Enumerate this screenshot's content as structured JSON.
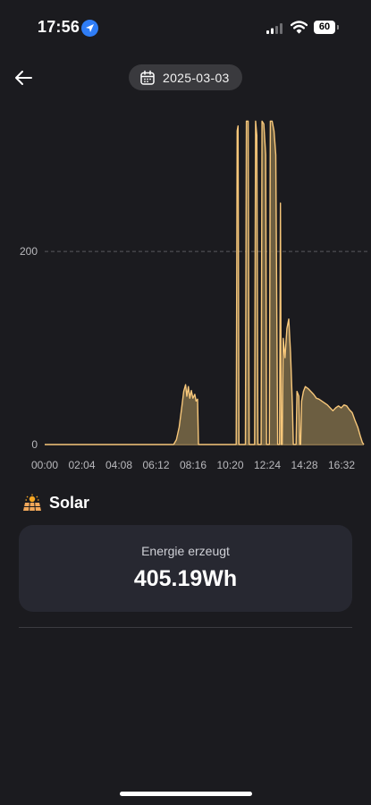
{
  "status_bar": {
    "time": "17:56",
    "battery": "60"
  },
  "header": {
    "date": "2025-03-03"
  },
  "chart_data": {
    "type": "area",
    "x_tick_labels": [
      "00:00",
      "02:04",
      "04:08",
      "06:12",
      "08:16",
      "10:20",
      "12:24",
      "14:28",
      "16:32"
    ],
    "y_ticks": [
      0,
      200
    ],
    "ylim": [
      0,
      340
    ],
    "xlim_hours": [
      0,
      17.33
    ],
    "grid": "horizontal dashed at 200",
    "color": "#f7c77a",
    "fill_color": "#7a6a48",
    "points": [
      [
        0.0,
        0
      ],
      [
        7.0,
        0
      ],
      [
        7.15,
        5
      ],
      [
        7.3,
        18
      ],
      [
        7.45,
        40
      ],
      [
        7.55,
        55
      ],
      [
        7.65,
        62
      ],
      [
        7.72,
        50
      ],
      [
        7.8,
        60
      ],
      [
        7.88,
        48
      ],
      [
        7.96,
        56
      ],
      [
        8.05,
        48
      ],
      [
        8.15,
        52
      ],
      [
        8.22,
        45
      ],
      [
        8.3,
        47
      ],
      [
        8.35,
        0
      ],
      [
        10.4,
        0
      ],
      [
        10.45,
        325
      ],
      [
        10.5,
        330
      ],
      [
        10.55,
        0
      ],
      [
        10.9,
        0
      ],
      [
        10.95,
        335
      ],
      [
        11.05,
        335
      ],
      [
        11.1,
        0
      ],
      [
        11.4,
        0
      ],
      [
        11.45,
        335
      ],
      [
        11.52,
        320
      ],
      [
        11.58,
        0
      ],
      [
        11.75,
        0
      ],
      [
        11.8,
        335
      ],
      [
        11.9,
        332
      ],
      [
        12.0,
        300
      ],
      [
        12.05,
        0
      ],
      [
        12.2,
        0
      ],
      [
        12.25,
        335
      ],
      [
        12.35,
        335
      ],
      [
        12.45,
        325
      ],
      [
        12.55,
        300
      ],
      [
        12.65,
        0
      ],
      [
        12.75,
        0
      ],
      [
        12.8,
        250
      ],
      [
        12.85,
        0
      ],
      [
        12.9,
        0
      ],
      [
        12.95,
        110
      ],
      [
        13.05,
        90
      ],
      [
        13.15,
        120
      ],
      [
        13.25,
        130
      ],
      [
        13.35,
        95
      ],
      [
        13.45,
        40
      ],
      [
        13.5,
        0
      ],
      [
        13.65,
        0
      ],
      [
        13.7,
        55
      ],
      [
        13.8,
        50
      ],
      [
        13.85,
        0
      ],
      [
        13.9,
        0
      ],
      [
        13.95,
        45
      ],
      [
        14.05,
        55
      ],
      [
        14.15,
        60
      ],
      [
        14.3,
        58
      ],
      [
        14.45,
        55
      ],
      [
        14.6,
        52
      ],
      [
        14.75,
        48
      ],
      [
        14.9,
        47
      ],
      [
        15.05,
        45
      ],
      [
        15.2,
        43
      ],
      [
        15.35,
        41
      ],
      [
        15.5,
        38
      ],
      [
        15.65,
        35
      ],
      [
        15.8,
        38
      ],
      [
        15.95,
        40
      ],
      [
        16.1,
        38
      ],
      [
        16.25,
        41
      ],
      [
        16.4,
        40
      ],
      [
        16.55,
        36
      ],
      [
        16.7,
        33
      ],
      [
        16.85,
        25
      ],
      [
        17.0,
        18
      ],
      [
        17.15,
        8
      ],
      [
        17.25,
        2
      ],
      [
        17.33,
        0
      ]
    ]
  },
  "solar_section": {
    "title": "Solar"
  },
  "energy_card": {
    "label": "Energie erzeugt",
    "value": "405.19Wh"
  }
}
